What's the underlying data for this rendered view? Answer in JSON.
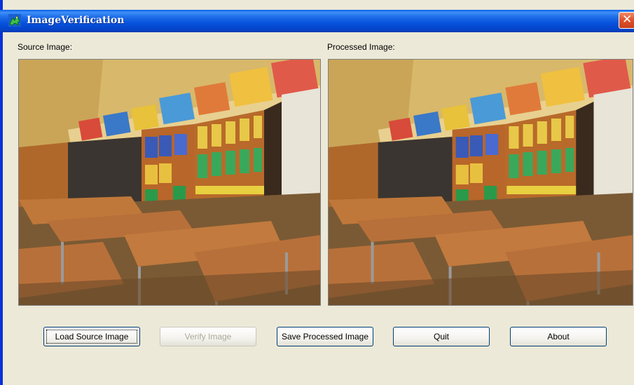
{
  "window": {
    "title": "ImageVerification",
    "close_glyph": "✕"
  },
  "labels": {
    "source": "Source Image:",
    "processed": "Processed Image:"
  },
  "buttons": {
    "load": "Load Source Image",
    "verify": "Verify Image",
    "save": "Save Processed Image",
    "quit": "Quit",
    "about": "About"
  },
  "icons": {
    "app": "green-dragon-icon",
    "close": "close-icon"
  },
  "colors": {
    "titlebar": "#0652dc",
    "window_bg": "#ece9d8",
    "close_red": "#e0502a",
    "disabled_text": "#aca899"
  }
}
